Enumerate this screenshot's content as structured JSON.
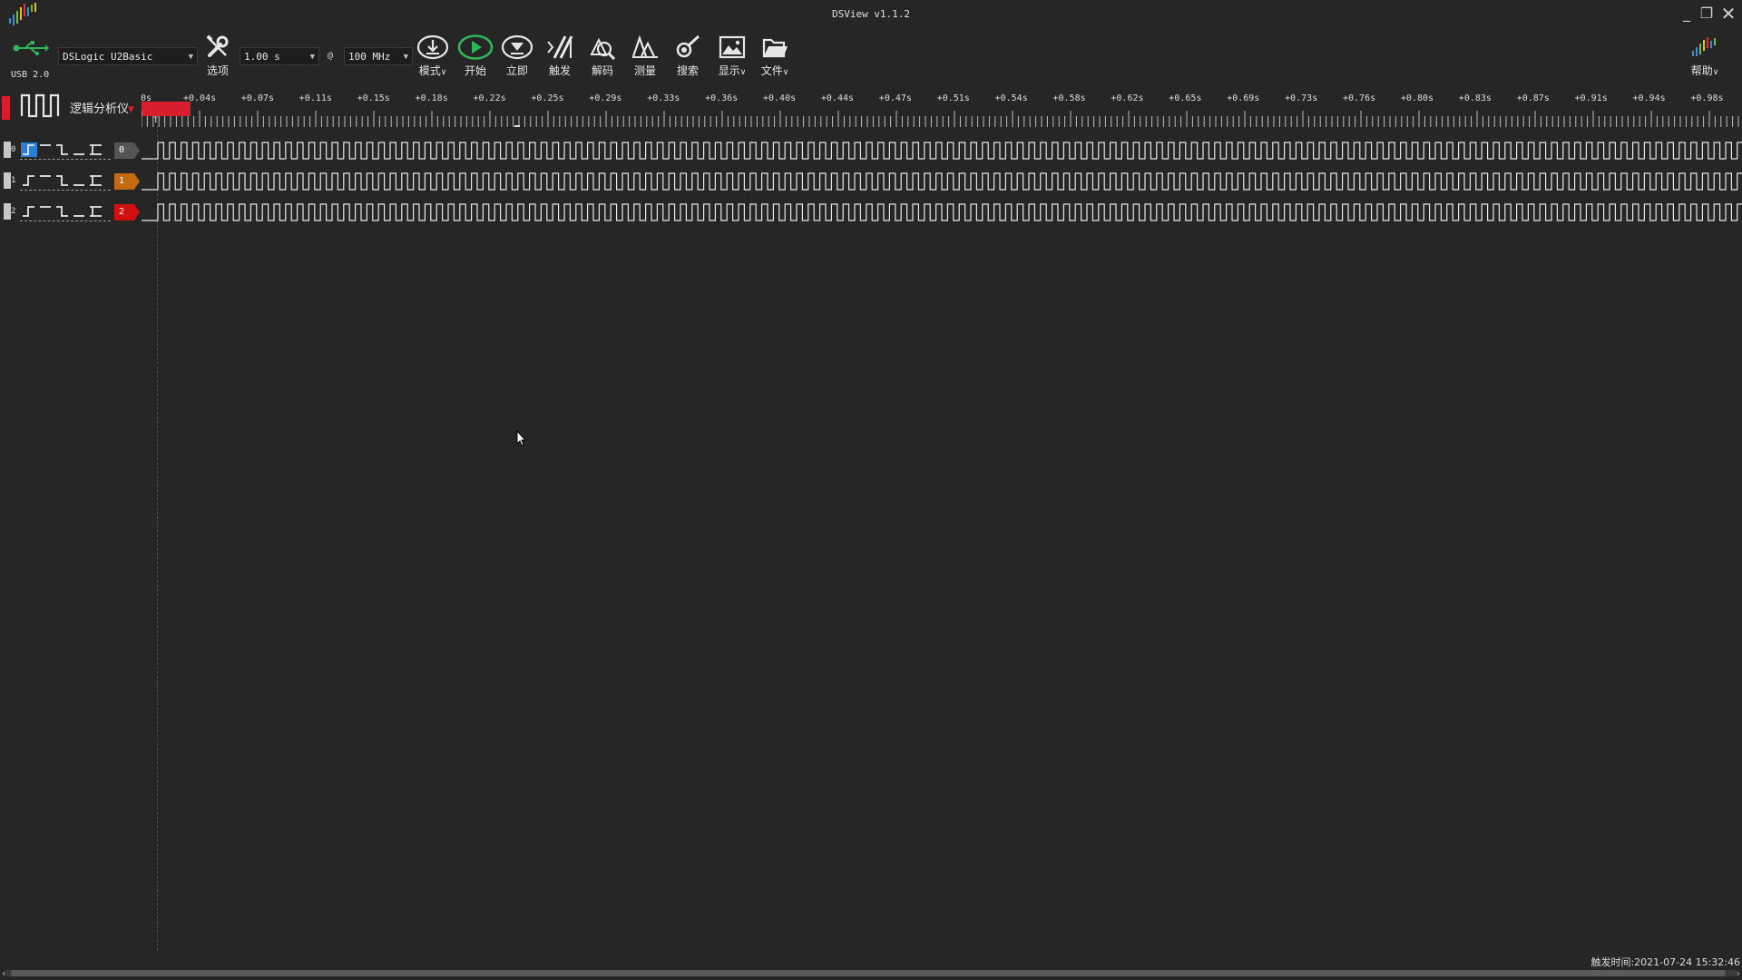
{
  "window": {
    "title": "DSView v1.1.2"
  },
  "device": {
    "usb_label": "USB 2.0",
    "name": "DSLogic U2Basic"
  },
  "toolbar": {
    "options_label": "选项",
    "duration": "1.00 s",
    "at_symbol": "@",
    "samplerate": "100 MHz",
    "mode_label": "模式",
    "start_label": "开始",
    "instant_label": "立即",
    "trigger_label": "触发",
    "decode_label": "解码",
    "measure_label": "测量",
    "search_label": "搜索",
    "display_label": "显示",
    "file_label": "文件",
    "help_label": "帮助"
  },
  "mode": {
    "label": "逻辑分析仪",
    "color": "#e02030"
  },
  "ruler": {
    "origin_label": "0s",
    "tick_labels": [
      "+0.04s",
      "+0.07s",
      "+0.11s",
      "+0.15s",
      "+0.18s",
      "+0.22s",
      "+0.25s",
      "+0.29s",
      "+0.33s",
      "+0.36s",
      "+0.40s",
      "+0.44s",
      "+0.47s",
      "+0.51s",
      "+0.54s",
      "+0.58s",
      "+0.62s",
      "+0.65s",
      "+0.69s",
      "+0.73s",
      "+0.76s",
      "+0.80s",
      "+0.83s",
      "+0.87s",
      "+0.91s",
      "+0.94s",
      "+0.98s"
    ],
    "trigger_marker": "T"
  },
  "channels": [
    {
      "index": "0",
      "badge": "0",
      "color": "#555555"
    },
    {
      "index": "1",
      "badge": "1",
      "color": "#c46a10"
    },
    {
      "index": "2",
      "badge": "2",
      "color": "#d01010"
    }
  ],
  "status": {
    "trigger_time": "触发时间:2021-07-24 15:32:46"
  },
  "icons": [
    "usb-icon",
    "wrench-icon",
    "mode-icon",
    "start-icon",
    "instant-icon",
    "trigger-icon",
    "decode-icon",
    "measure-icon",
    "search-icon",
    "display-icon",
    "file-icon",
    "help-icon",
    "logic-mode-icon"
  ],
  "colors": {
    "accent_green": "#2fb55a",
    "trigger_red": "#d81e2c",
    "background": "#262626"
  }
}
